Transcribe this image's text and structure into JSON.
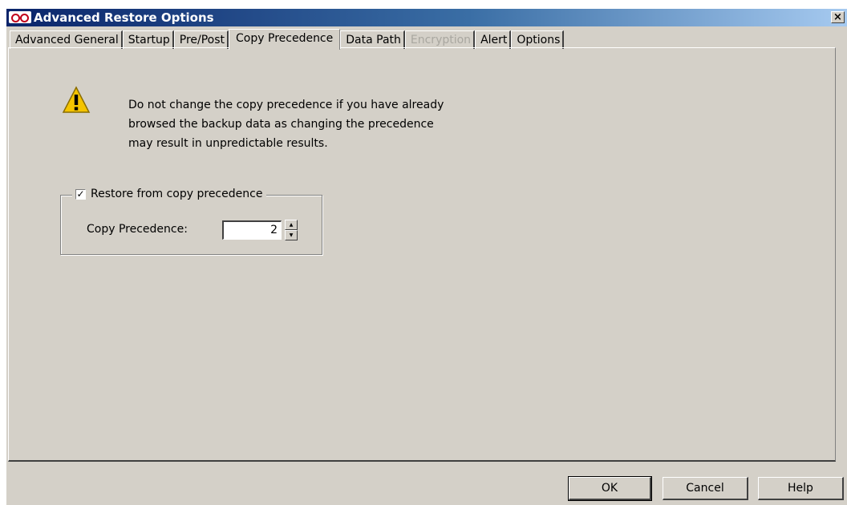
{
  "window": {
    "title": "Advanced Restore Options",
    "close_label": "×"
  },
  "tabs": [
    {
      "label": "Advanced General"
    },
    {
      "label": "Startup"
    },
    {
      "label": "Pre/Post"
    },
    {
      "label": "Copy Precedence",
      "active": true
    },
    {
      "label": "Data Path"
    },
    {
      "label": "Encryption",
      "disabled": true
    },
    {
      "label": "Alert"
    },
    {
      "label": "Options"
    }
  ],
  "warning": {
    "icon": "warning-icon",
    "lines": [
      "Do not change the copy precedence if you have already",
      "browsed the backup data as changing the precedence",
      "may result in unpredictable results."
    ]
  },
  "restore_group": {
    "checkbox_label": "Restore from copy precedence",
    "checked": true,
    "copy_precedence_label": "Copy Precedence:",
    "copy_precedence_value": "2"
  },
  "buttons": {
    "ok": "OK",
    "cancel": "Cancel",
    "help": "Help"
  },
  "colors": {
    "titlebar_start": "#0a246a",
    "titlebar_end": "#a6caf0",
    "dialog_bg": "#d4d0c8",
    "warning_yellow": "#f5c400"
  }
}
